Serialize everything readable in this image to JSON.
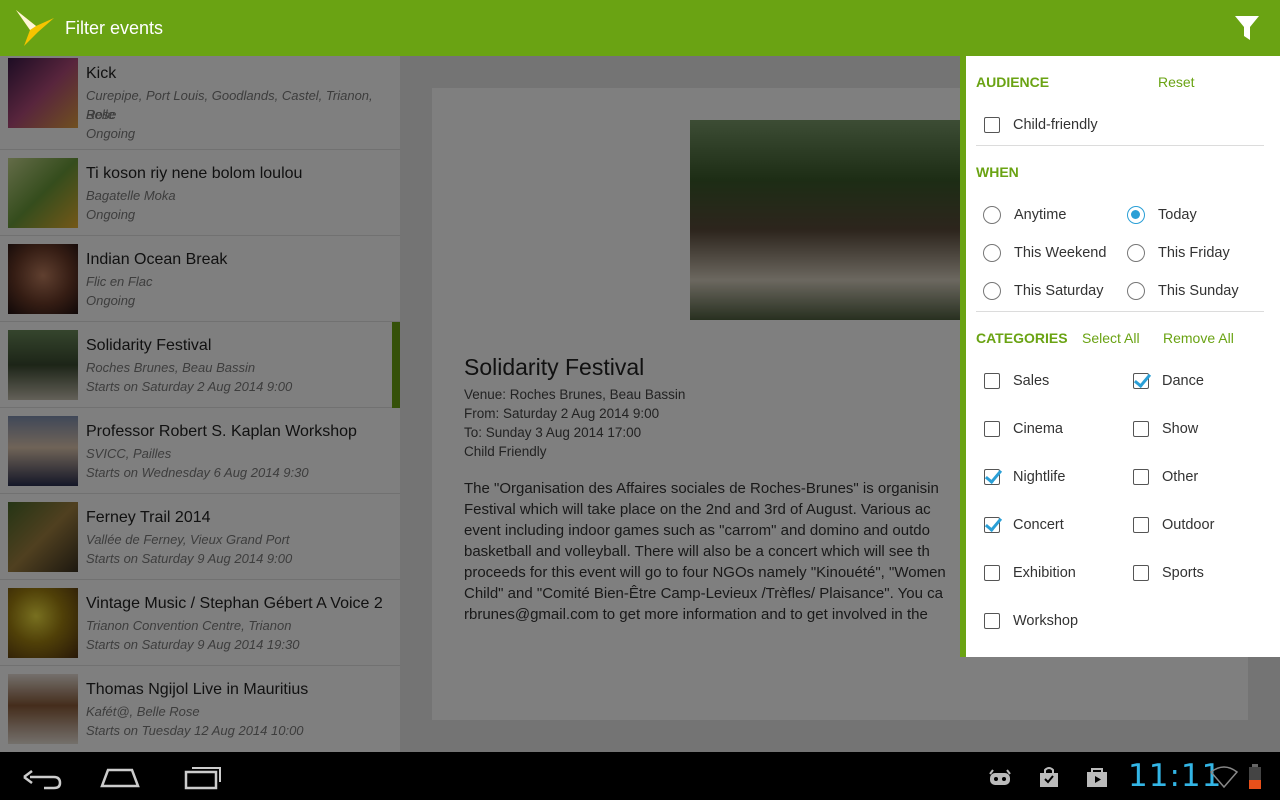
{
  "app": {
    "title": "Filter events",
    "accent": "#6aa313"
  },
  "events": [
    {
      "title": "Kick",
      "venue_line1": "Curepipe, Port Louis, Goodlands, Castel, Trianon, Rose",
      "venue_line2": "Belle",
      "when": "Ongoing",
      "thumb_color": "#8a3a6a"
    },
    {
      "title": "Ti koson riy nene bolom loulou",
      "venue_line1": "Bagatelle Moka",
      "when": "Ongoing",
      "thumb_color": "#7aa04a"
    },
    {
      "title": "Indian Ocean Break",
      "venue_line1": "Flic en Flac",
      "when": "Ongoing",
      "thumb_color": "#6b4030"
    },
    {
      "title": "Solidarity Festival",
      "venue_line1": "Roches Brunes, Beau Bassin",
      "when": "Starts on Saturday 2 Aug 2014 9:00",
      "thumb_color": "#4a6a3a",
      "selected": true
    },
    {
      "title": "Professor Robert S. Kaplan Workshop",
      "venue_line1": "SVICC, Pailles",
      "when": "Starts on Wednesday 6 Aug 2014 9:30",
      "thumb_color": "#3a4a7a"
    },
    {
      "title": "Ferney Trail 2014",
      "venue_line1": "Vallée de Ferney, Vieux Grand Port",
      "when": "Starts on Saturday 9 Aug 2014 9:00",
      "thumb_color": "#6a5a2a"
    },
    {
      "title": "Vintage Music / Stephan Gébert A Voice 2",
      "venue_line1": "Trianon Convention Centre, Trianon",
      "when": "Starts on Saturday 9 Aug 2014 19:30",
      "thumb_color": "#8a7a10"
    },
    {
      "title": "Thomas Ngijol Live in Mauritius",
      "venue_line1": "Kafét@, Belle Rose",
      "when": "Starts on Tuesday 12 Aug 2014 10:00",
      "thumb_color": "#5a3a25"
    }
  ],
  "detail": {
    "title": "Solidarity Festival",
    "venue": "Venue: Roches Brunes, Beau Bassin",
    "from": "From: Saturday 2 Aug 2014 9:00",
    "to": "To: Sunday 3 Aug 2014 17:00",
    "audience": "Child Friendly",
    "description_lines": [
      "The \"Organisation des Affaires sociales de Roches-Brunes\" is organisin",
      "Festival which will take place on the 2nd and 3rd of August. Various ac",
      "event including indoor games such as \"carrom\" and domino and outdo",
      "basketball and volleyball. There will also be a concert which will see th",
      "proceeds for this event will go to four NGOs namely \"Kinouété\", \"Women",
      "Child\" and \"Comité Bien-Être Camp-Levieux /Trèfles/ Plaisance\". You ca",
      "rbrunes@gmail.com to get more information and to get involved in the"
    ]
  },
  "filter": {
    "audience": {
      "heading": "AUDIENCE",
      "reset_label": "Reset",
      "options": [
        {
          "label": "Child-friendly",
          "checked": false
        }
      ]
    },
    "when": {
      "heading": "WHEN",
      "options": [
        {
          "label": "Anytime",
          "selected": false
        },
        {
          "label": "Today",
          "selected": true
        },
        {
          "label": "This Weekend",
          "selected": false
        },
        {
          "label": "This Friday",
          "selected": false
        },
        {
          "label": "This Saturday",
          "selected": false
        },
        {
          "label": "This Sunday",
          "selected": false
        }
      ]
    },
    "categories": {
      "heading": "CATEGORIES",
      "select_all_label": "Select All",
      "remove_all_label": "Remove All",
      "options": [
        {
          "label": "Sales",
          "checked": false
        },
        {
          "label": "Dance",
          "checked": true
        },
        {
          "label": "Cinema",
          "checked": false
        },
        {
          "label": "Show",
          "checked": false
        },
        {
          "label": "Nightlife",
          "checked": true
        },
        {
          "label": "Other",
          "checked": false
        },
        {
          "label": "Concert",
          "checked": true
        },
        {
          "label": "Outdoor",
          "checked": false
        },
        {
          "label": "Exhibition",
          "checked": false
        },
        {
          "label": "Sports",
          "checked": false
        },
        {
          "label": "Workshop",
          "checked": false
        }
      ]
    }
  },
  "status_bar": {
    "clock": "11:11",
    "clock_color": "#33b5e5",
    "icons": [
      "android-debug-icon",
      "shopping-bag-icon",
      "play-store-icon",
      "wifi-icon",
      "battery-icon"
    ]
  },
  "nav": {
    "icons": [
      "back-icon",
      "home-icon",
      "recent-apps-icon"
    ]
  }
}
